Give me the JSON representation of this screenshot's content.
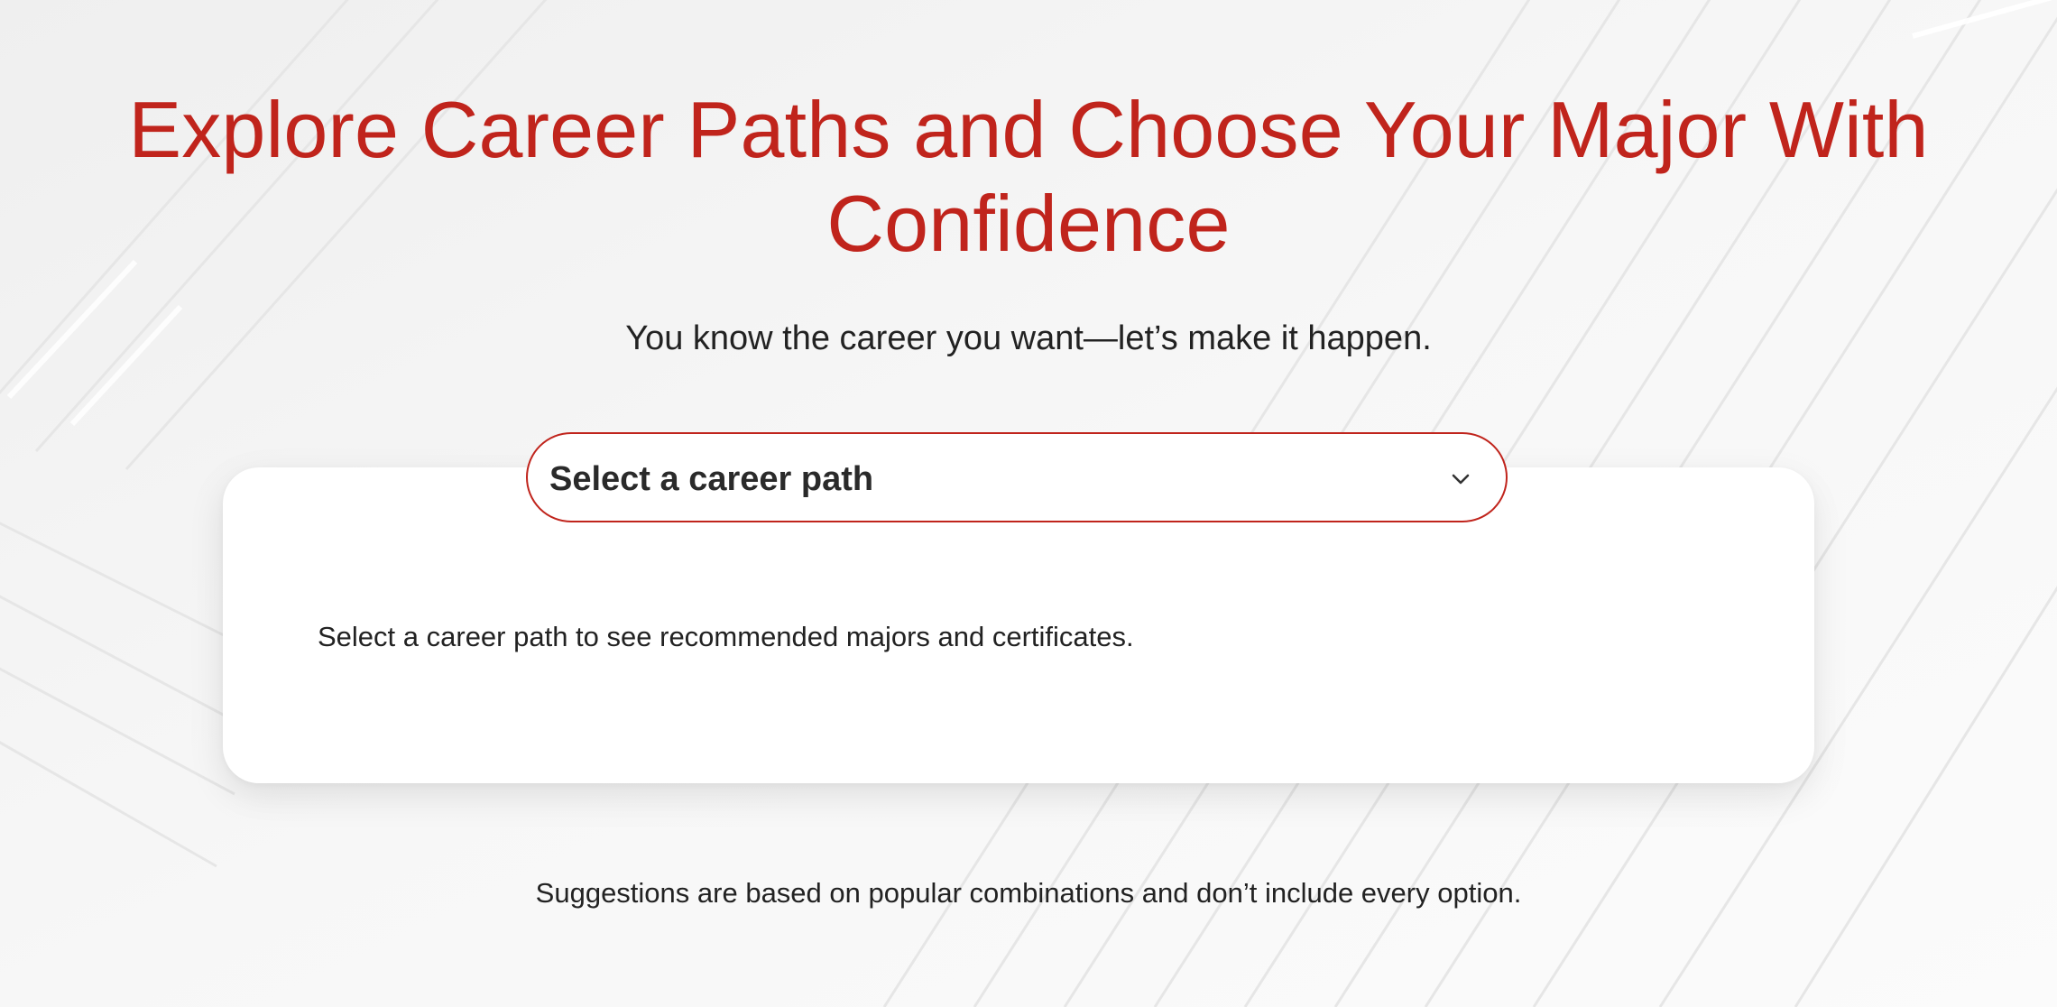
{
  "hero": {
    "title": "Explore Career Paths and Choose Your Major With Confidence",
    "subtitle": "You know the career you want—let’s make it happen."
  },
  "career_select": {
    "selected_label": "Select a career path",
    "icon": "chevron-down-icon"
  },
  "results": {
    "empty_message": "Select a career path to see recommended majors and certificates."
  },
  "footer_note": "Suggestions are based on popular combinations and don’t include every option.",
  "colors": {
    "accent": "#c0241c",
    "text": "#222222",
    "card_background": "#ffffff",
    "page_background": "#f4f4f4"
  }
}
